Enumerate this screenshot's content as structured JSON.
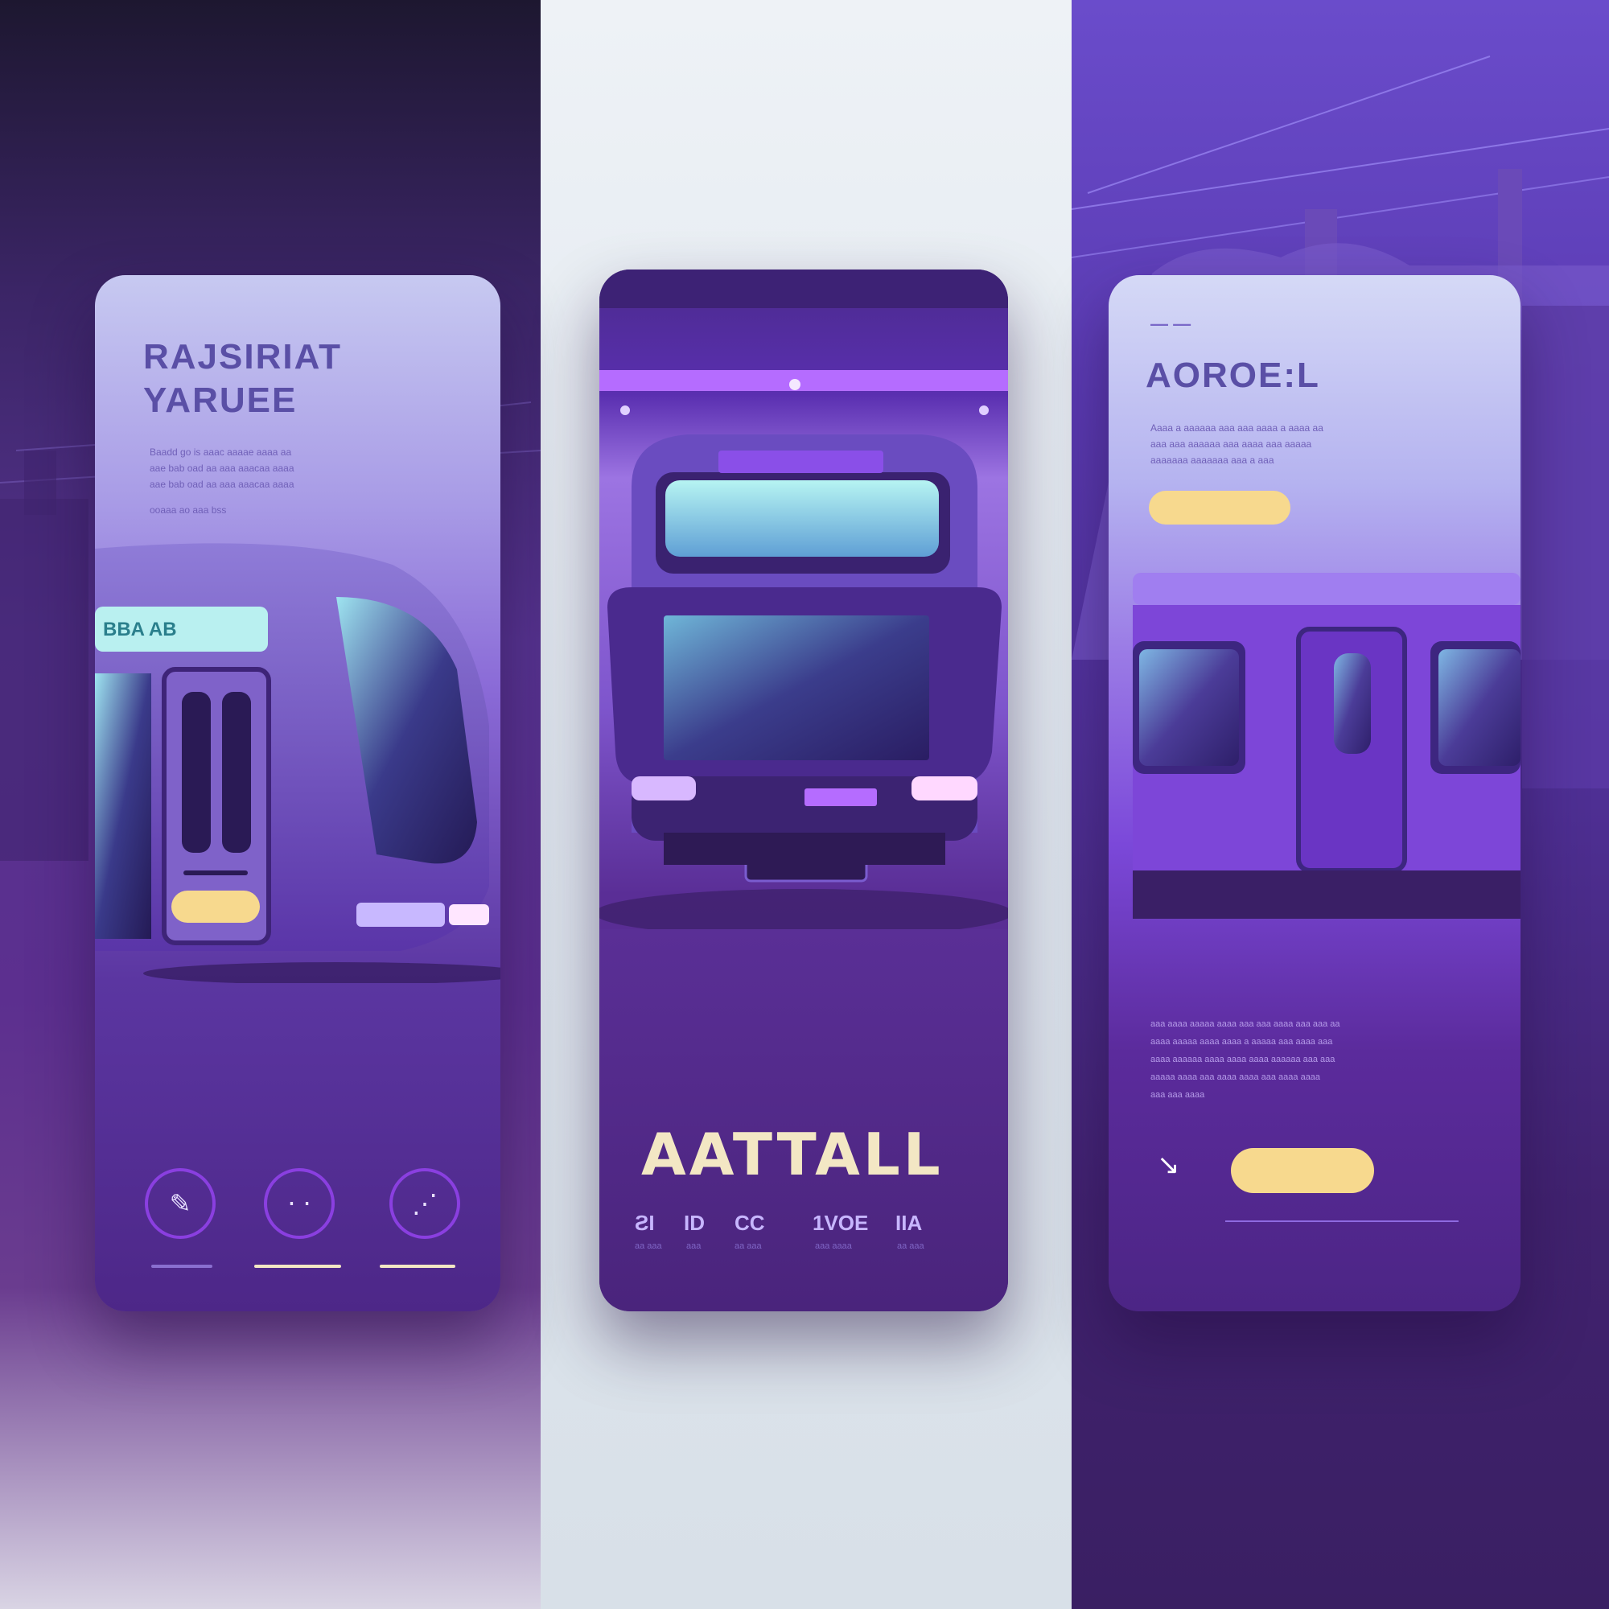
{
  "screens": [
    {
      "title_line1": "RAJSIRIAT",
      "title_line2": "YARUEE",
      "body": [
        "Baadd go is aaac aaaae aaaa aa",
        "aae bab oad aa aaa aaacaa aaaa",
        "aae bab oad aa aaa aaacaa aaaa",
        "ooaaa ao aaa bss"
      ],
      "bus_display_text": "BBA AB",
      "nav": [
        {
          "icon": "edit-icon",
          "glyph": "✎"
        },
        {
          "icon": "dots-icon",
          "glyph": "⋅ ⋅"
        },
        {
          "icon": "grid-icon",
          "glyph": "⋰"
        }
      ]
    },
    {
      "headline": "AATTALL",
      "stats": [
        {
          "value": "ƧI",
          "sub": "aa aaa"
        },
        {
          "value": "ID",
          "sub": "aaa"
        },
        {
          "value": "CC",
          "sub": "aa aaa"
        },
        {
          "value": "1VOE",
          "sub": "aaa aaaa"
        },
        {
          "value": "IIA",
          "sub": "aa aaa"
        }
      ]
    },
    {
      "dash_marks": "— —",
      "title": "AOROE:L",
      "body": [
        "Aaaa a aaaaaa aaa aaa aaaa a aaaa aa",
        "aaa aaa aaaaaa aaa aaaa aaa aaaaa",
        "aaaaaaa aaaaaaa aaa a aaa"
      ],
      "lower_body": [
        "aaa aaaa aaaaa aaaa aaa aaa aaaa aaa aaa aa",
        "aaaa aaaaa aaaa aaaa a aaaaa aaa aaaa aaa",
        "aaaa aaaaaa aaaa aaaa aaaa aaaaaa aaa aaa",
        "aaaaa aaaa aaa aaaa aaaa aaa aaaa aaaa",
        "aaa aaa aaaa"
      ],
      "arrow_glyph": "↘"
    }
  ],
  "colors": {
    "accent_yellow": "#f7d98e",
    "purple_dark": "#3a1f63",
    "purple_accent": "#8a3fe0",
    "headline_cream": "#f3e7c4"
  }
}
